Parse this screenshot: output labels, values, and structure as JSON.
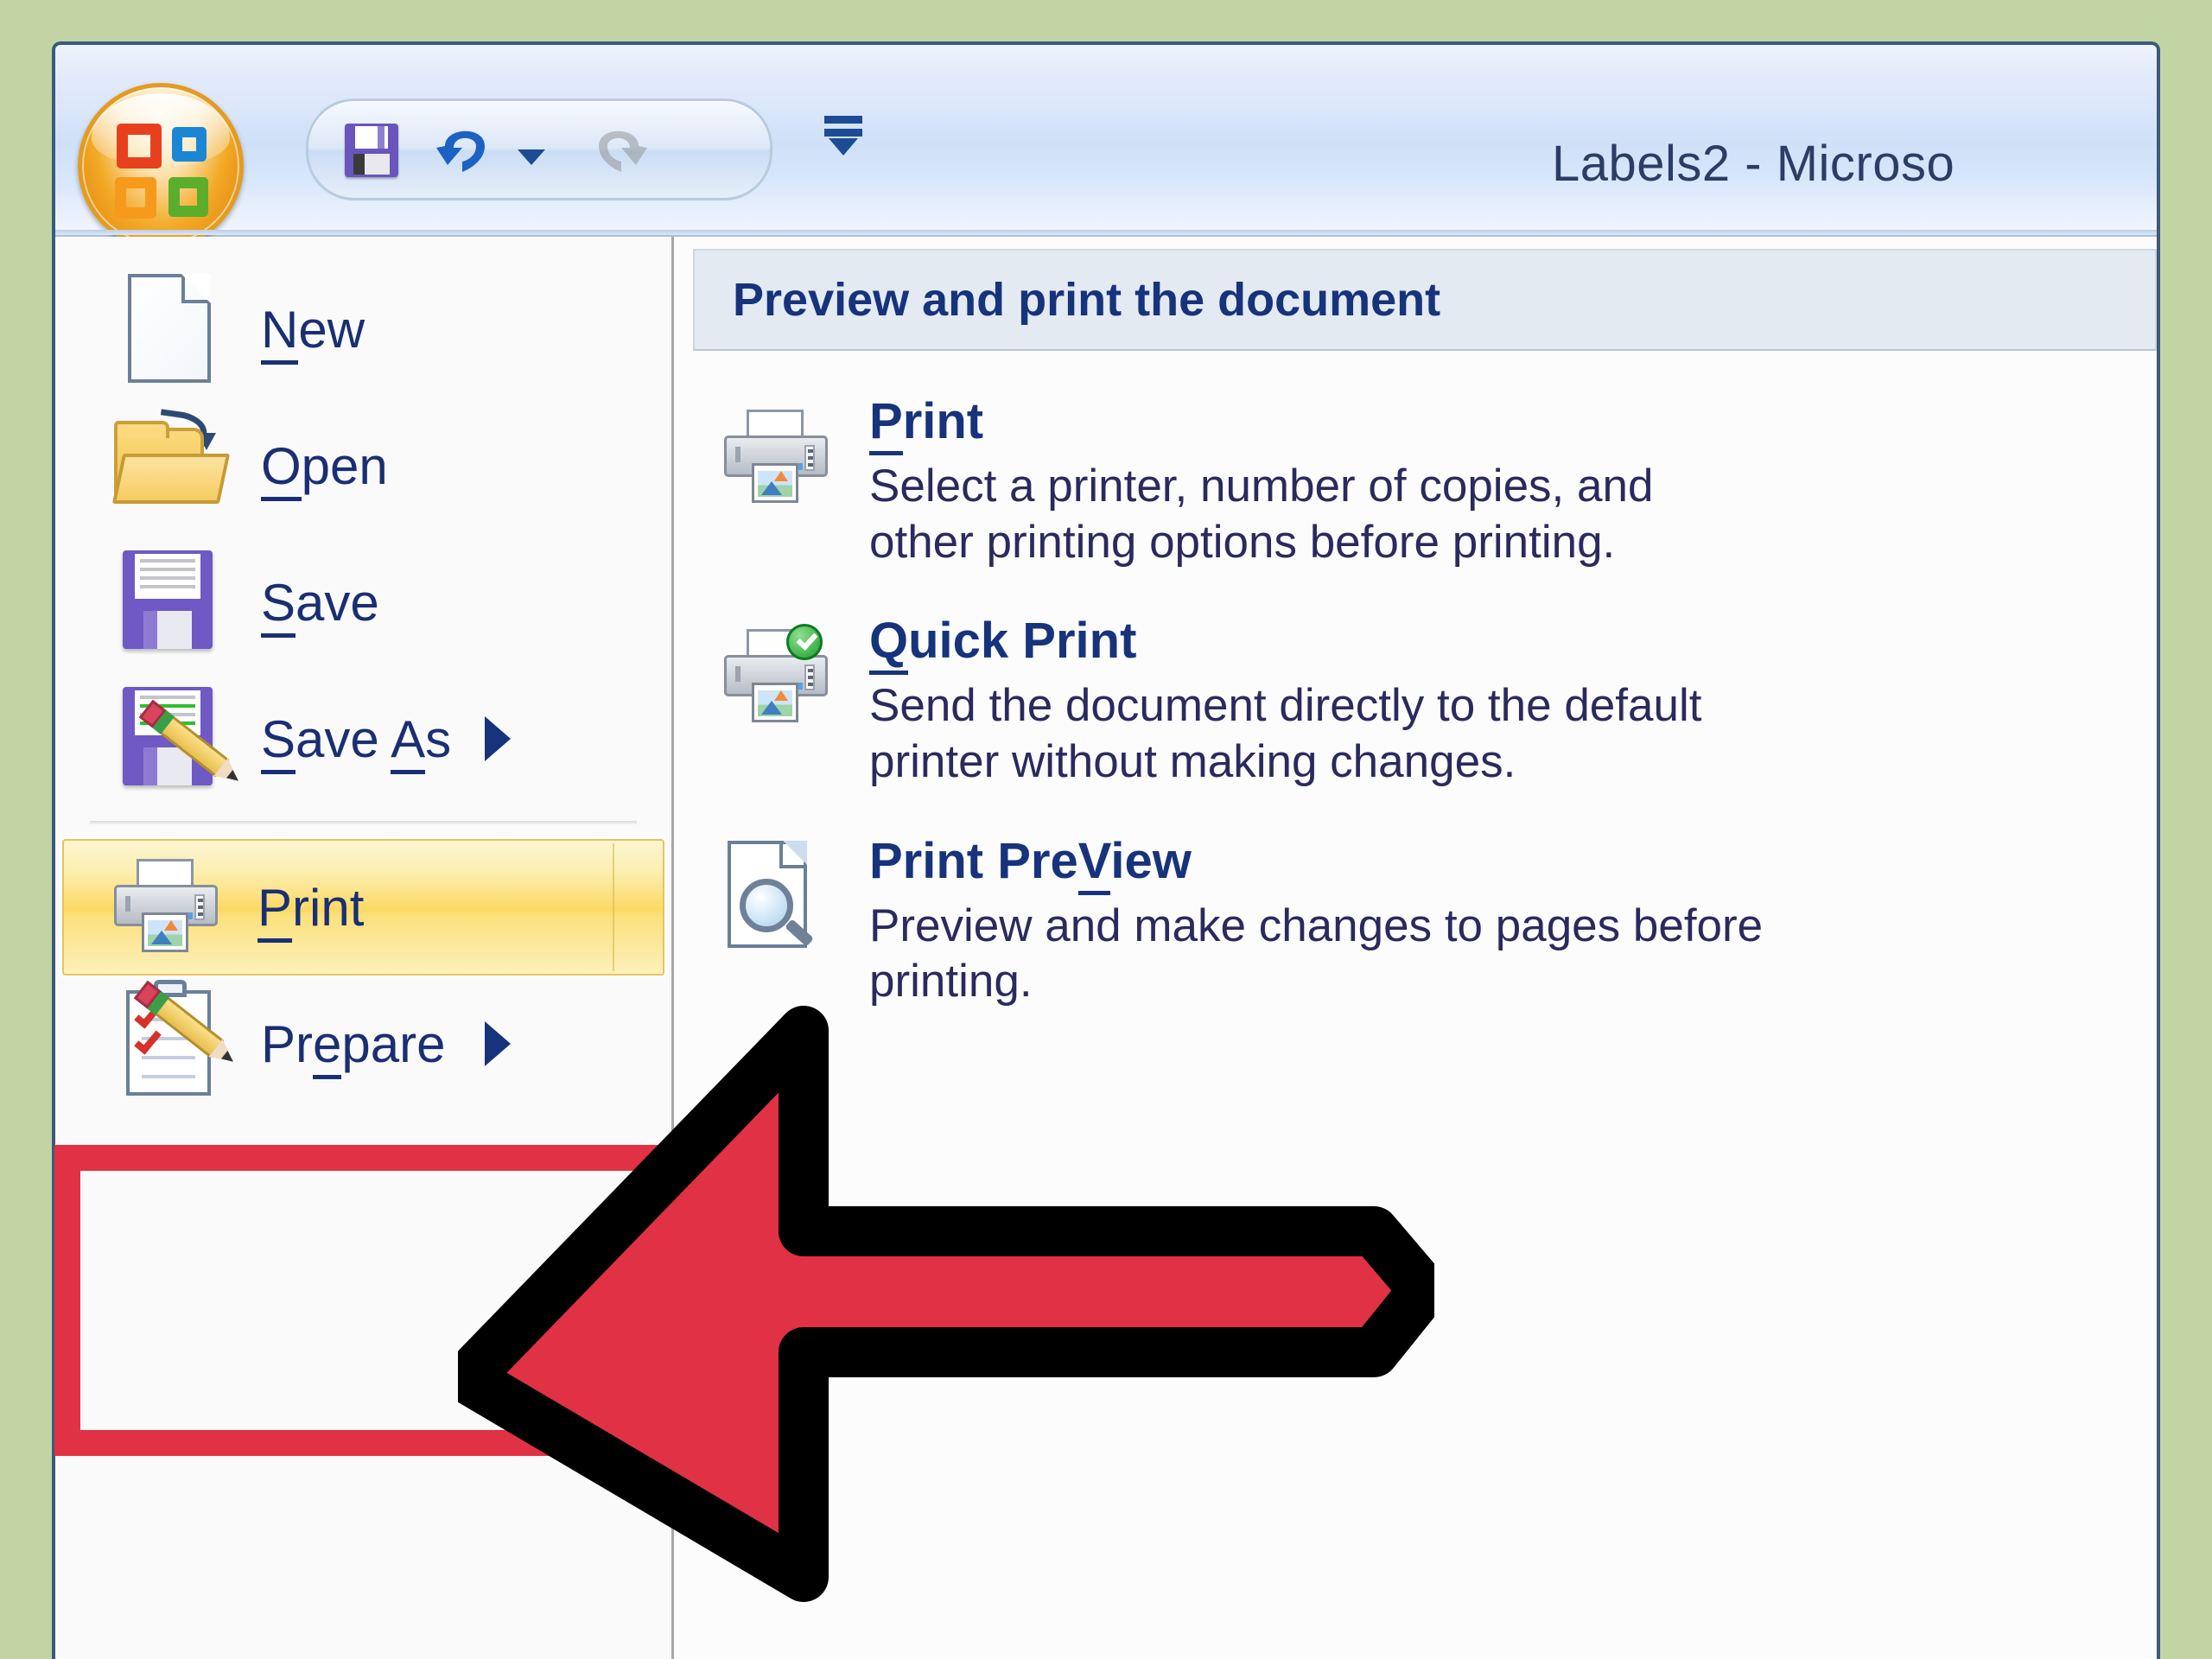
{
  "window": {
    "title": "Labels2 - Microso",
    "office_button": "office-orb-button"
  },
  "quick_access_toolbar": {
    "save": "Save",
    "undo": "Undo",
    "undo_dropdown": "Undo history",
    "redo": "Redo",
    "customize": "Customize Quick Access Toolbar"
  },
  "left_menu": {
    "items": [
      {
        "label_pre": "",
        "label_key": "N",
        "label_post": "ew",
        "icon": "new-document-icon",
        "has_submenu": false,
        "selected": false
      },
      {
        "label_pre": "",
        "label_key": "O",
        "label_post": "pen",
        "icon": "open-folder-icon",
        "has_submenu": false,
        "selected": false
      },
      {
        "label_pre": "",
        "label_key": "S",
        "label_post": "ave",
        "icon": "save-floppy-icon",
        "has_submenu": false,
        "selected": false
      },
      {
        "label_pre": "",
        "label_key": "S",
        "label_post": "ave ",
        "label_key2": "A",
        "label_post2": "s",
        "icon": "save-as-icon",
        "has_submenu": true,
        "selected": false
      },
      {
        "label_pre": "",
        "label_key": "P",
        "label_post": "rint",
        "icon": "printer-icon",
        "has_submenu": false,
        "selected": true
      },
      {
        "label_pre": "Pr",
        "label_key": "e",
        "label_post": "pare",
        "icon": "prepare-icon",
        "has_submenu": true,
        "selected": false
      }
    ]
  },
  "right_panel": {
    "header": "Preview and print the document",
    "items": [
      {
        "title_key": "P",
        "title_rest": "rint",
        "icon": "printer-icon",
        "description": "Select a printer, number of copies, and\nother printing options before printing."
      },
      {
        "title_key": "Q",
        "title_rest": "uick Print",
        "icon": "quick-print-icon",
        "description": "Send the document directly to the default\nprinter without making changes."
      },
      {
        "title_key": "V",
        "title_rest": "iew",
        "title_prefix": "Print Pre",
        "icon": "print-preview-icon",
        "description": "Preview and make changes to pages before\nprinting."
      }
    ]
  },
  "annotations": {
    "highlight_target": "Print",
    "highlight_color": "#e03244",
    "arrow_fill": "#e03244",
    "arrow_outline": "#000000",
    "arrow_direction": "left"
  },
  "colors": {
    "page_background": "#c2d4a4",
    "window_border": "#3b5a7d",
    "menu_text": "#16337c",
    "selected_highlight": "#fbd964"
  }
}
